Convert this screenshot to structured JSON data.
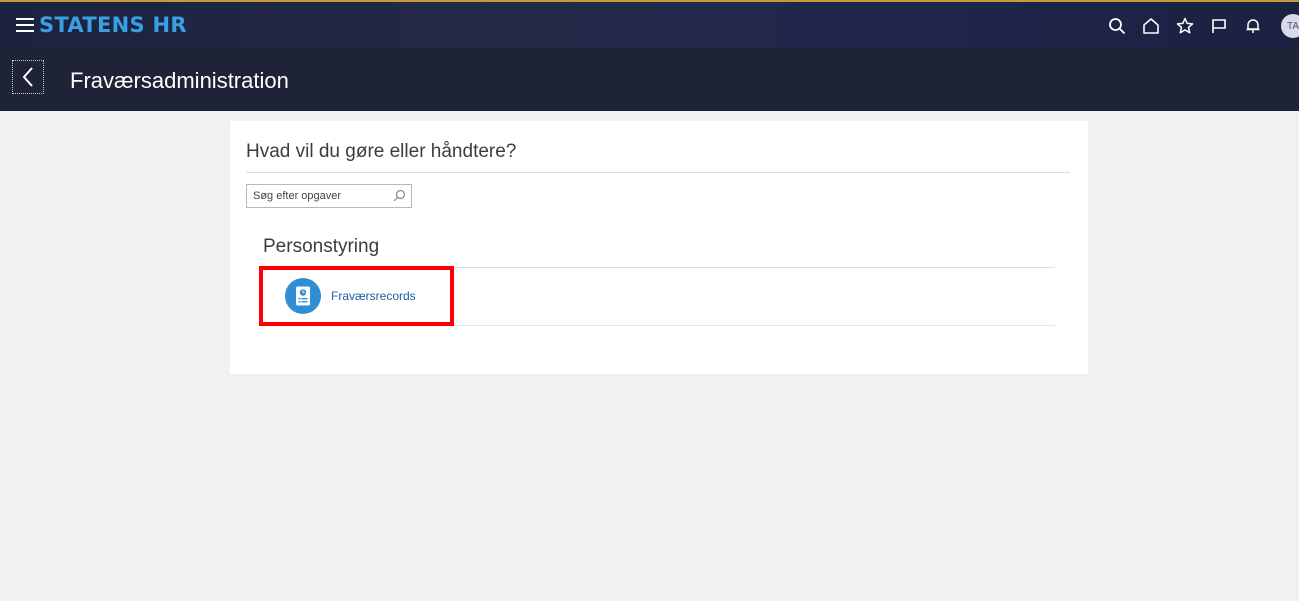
{
  "header": {
    "brand": "STATENS HR",
    "icons": [
      "search-icon",
      "home-icon",
      "star-icon",
      "flag-icon",
      "bell-icon"
    ],
    "avatar_initials": "TA",
    "colors": {
      "brand": "#3aa0e6",
      "bar": "#1f2338"
    }
  },
  "subheader": {
    "title": "Fraværsadministration"
  },
  "main": {
    "heading": "Hvad vil du gøre eller håndtere?",
    "search": {
      "placeholder": "Søg efter opgaver",
      "value": ""
    },
    "section": {
      "title": "Personstyring",
      "tasks": [
        {
          "label": "Fraværsrecords",
          "icon": "absence-record-icon"
        }
      ]
    },
    "highlight_color": "#ff0000"
  }
}
